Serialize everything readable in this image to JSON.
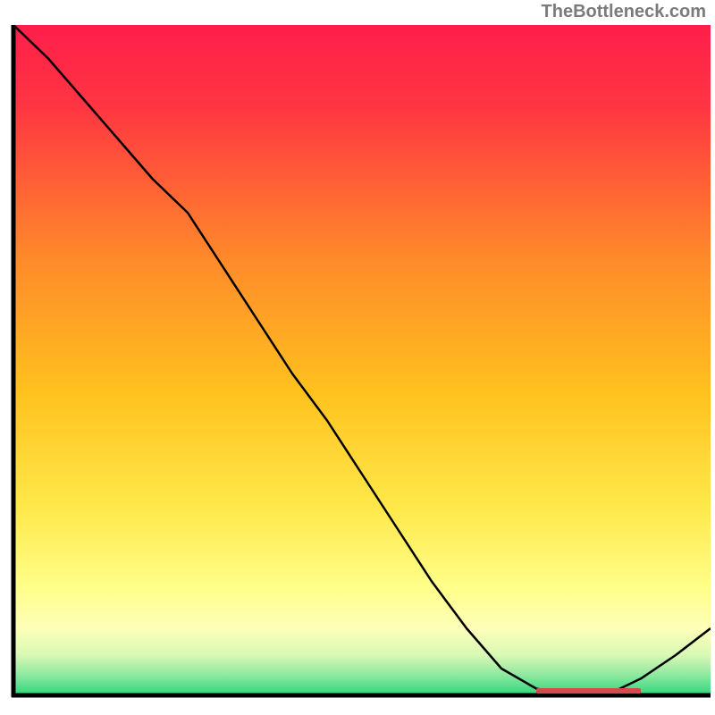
{
  "watermark": "TheBottleneck.com",
  "chart_data": {
    "type": "line",
    "title": "",
    "xlabel": "",
    "ylabel": "",
    "x": [
      0,
      5,
      10,
      15,
      20,
      25,
      30,
      35,
      40,
      45,
      50,
      55,
      60,
      65,
      70,
      75,
      80,
      85,
      90,
      95,
      100
    ],
    "values": [
      100,
      95,
      89,
      83,
      77,
      72,
      64,
      56,
      48,
      41,
      33,
      25,
      17,
      10,
      4,
      1,
      0,
      0,
      2.5,
      6,
      10
    ],
    "xlim": [
      0,
      100
    ],
    "ylim": [
      0,
      100
    ],
    "background_gradient": {
      "top_color": "#ff1e4b",
      "mid_color": "#ffd400",
      "lower_mid_color": "#ffff8a",
      "bottom_color": "#2dd67a"
    },
    "marker_region": {
      "x_start": 75,
      "x_end": 90,
      "color": "#d24a4a"
    }
  }
}
